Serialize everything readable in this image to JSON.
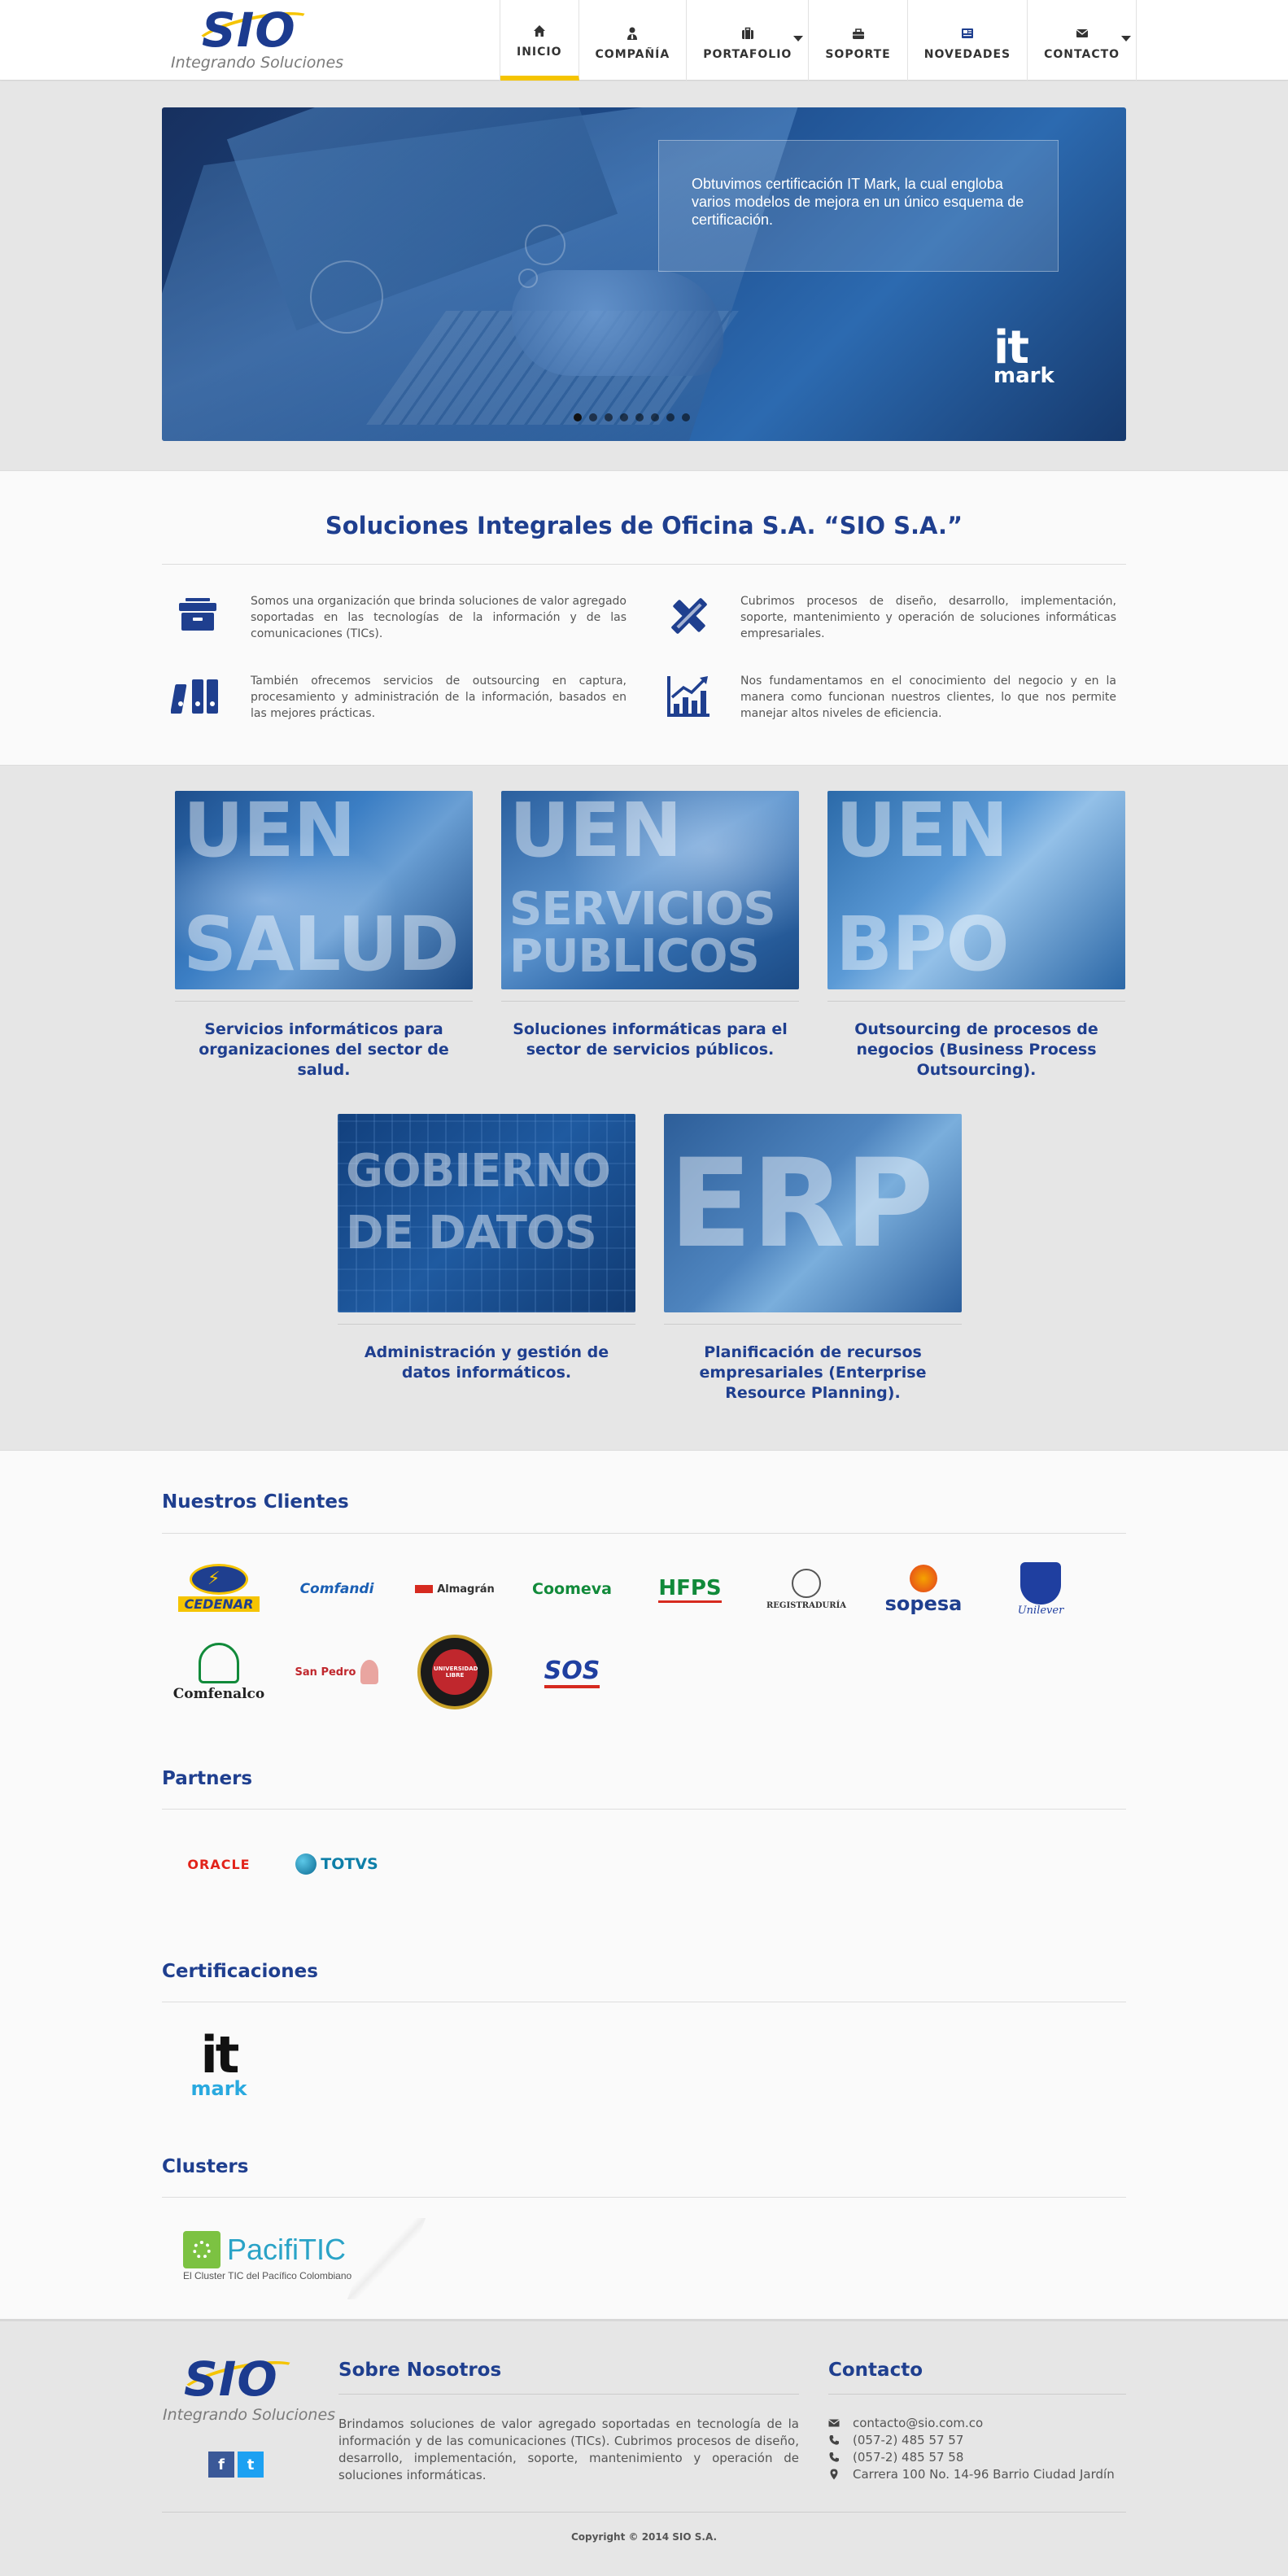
{
  "header": {
    "logo_text": "SIO",
    "logo_tagline": "Integrando Soluciones",
    "nav": [
      {
        "label": "INICIO",
        "icon": "home-icon",
        "active": true
      },
      {
        "label": "COMPAÑÍA",
        "icon": "user-tie-icon"
      },
      {
        "label": "PORTAFOLIO",
        "icon": "briefcase-icon",
        "dropdown": true
      },
      {
        "label": "SOPORTE",
        "icon": "toolbox-icon"
      },
      {
        "label": "NOVEDADES",
        "icon": "newspaper-icon"
      },
      {
        "label": "CONTACTO",
        "icon": "envelope-icon",
        "dropdown": true
      }
    ]
  },
  "slider": {
    "caption": "Obtuvimos certificación IT Mark, la cual engloba varios modelos de mejora en un único esquema de certificación.",
    "badge_top": "it",
    "badge_bottom": "mark",
    "slide_count": 8,
    "active_slide": 1
  },
  "intro": {
    "title": "Soluciones Integrales de Oficina S.A. “SIO S.A.”",
    "features": [
      {
        "icon": "archive-box-icon",
        "text": "Somos una organización que brinda soluciones de valor agregado soportadas en las tecnologías de la información y de las comunicaciones (TICs)."
      },
      {
        "icon": "pencil-ruler-icon",
        "text": "Cubrimos procesos de diseño, desarrollo, implementación, soporte, mantenimiento y operación de soluciones informáticas empresariales."
      },
      {
        "icon": "binders-icon",
        "text": "También ofrecemos servicios de outsourcing en captura, procesamiento y administración de la información, basados en las mejores prácticas."
      },
      {
        "icon": "growth-chart-icon",
        "text": "Nos fundamentamos en el conocimiento del negocio y en la manera como funcionan nuestros clientes, lo que nos permite manejar altos niveles de eficiencia."
      }
    ]
  },
  "uen": [
    {
      "line1": "UEN",
      "line2": "SALUD",
      "desc": "Servicios informáticos para organizaciones del sector de salud."
    },
    {
      "line1": "UEN",
      "line2": "SERVICIOS",
      "line3": "PUBLICOS",
      "desc": "Soluciones informáticas para el sector de servicios públicos."
    },
    {
      "line1": "UEN",
      "line2": "BPO",
      "desc": "Outsourcing de procesos de negocios (Business Process Outsourcing)."
    },
    {
      "line1": "GOBIERNO",
      "line2": "DE DATOS",
      "desc": "Administración y gestión de datos informáticos."
    },
    {
      "line1": "ERP",
      "desc": "Planificación de recursos empresariales (Enterprise Resource Planning)."
    }
  ],
  "clients": {
    "title": "Nuestros Clientes",
    "logos": [
      "CEDENAR",
      "Comfandi",
      "Almagrán",
      "Coomeva",
      "HFPS",
      "REGISTRADURÍA",
      "sopesa",
      "Unilever",
      "Comfenalco",
      "San Pedro",
      "UNIVERSIDAD LIBRE",
      "SOS"
    ]
  },
  "partners": {
    "title": "Partners",
    "logos": [
      "ORACLE",
      "TOTVS"
    ]
  },
  "certifications": {
    "title": "Certificaciones",
    "logos": [
      "it",
      "mark"
    ]
  },
  "clusters": {
    "title": "Clusters",
    "logo_name": "PacifiTIC",
    "logo_sub": "El Cluster TIC del Pacífico Colombiano"
  },
  "footer": {
    "logo_text": "SIO",
    "logo_tagline": "Integrando Soluciones",
    "about_title": "Sobre Nosotros",
    "about_text": "Brindamos soluciones de valor agregado soportadas en tecnología de la información y de las comunicaciones (TICs). Cubrimos procesos de diseño, desarrollo, implementación, soporte, mantenimiento y operación de soluciones informáticas.",
    "contact_title": "Contacto",
    "contact": {
      "email": "contacto@sio.com.co",
      "phone1": "(057-2) 485 57 57",
      "phone2": "(057-2) 485 57 58",
      "address": "Carrera 100 No. 14-96 Barrio Ciudad Jardín"
    },
    "copyright": "Copyright © 2014 SIO S.A.",
    "social": [
      "f",
      "t"
    ]
  },
  "colors": {
    "brand_blue": "#1f3f8f",
    "accent_yellow": "#f5c400",
    "facebook": "#3b5998",
    "twitter": "#1da1f2"
  }
}
